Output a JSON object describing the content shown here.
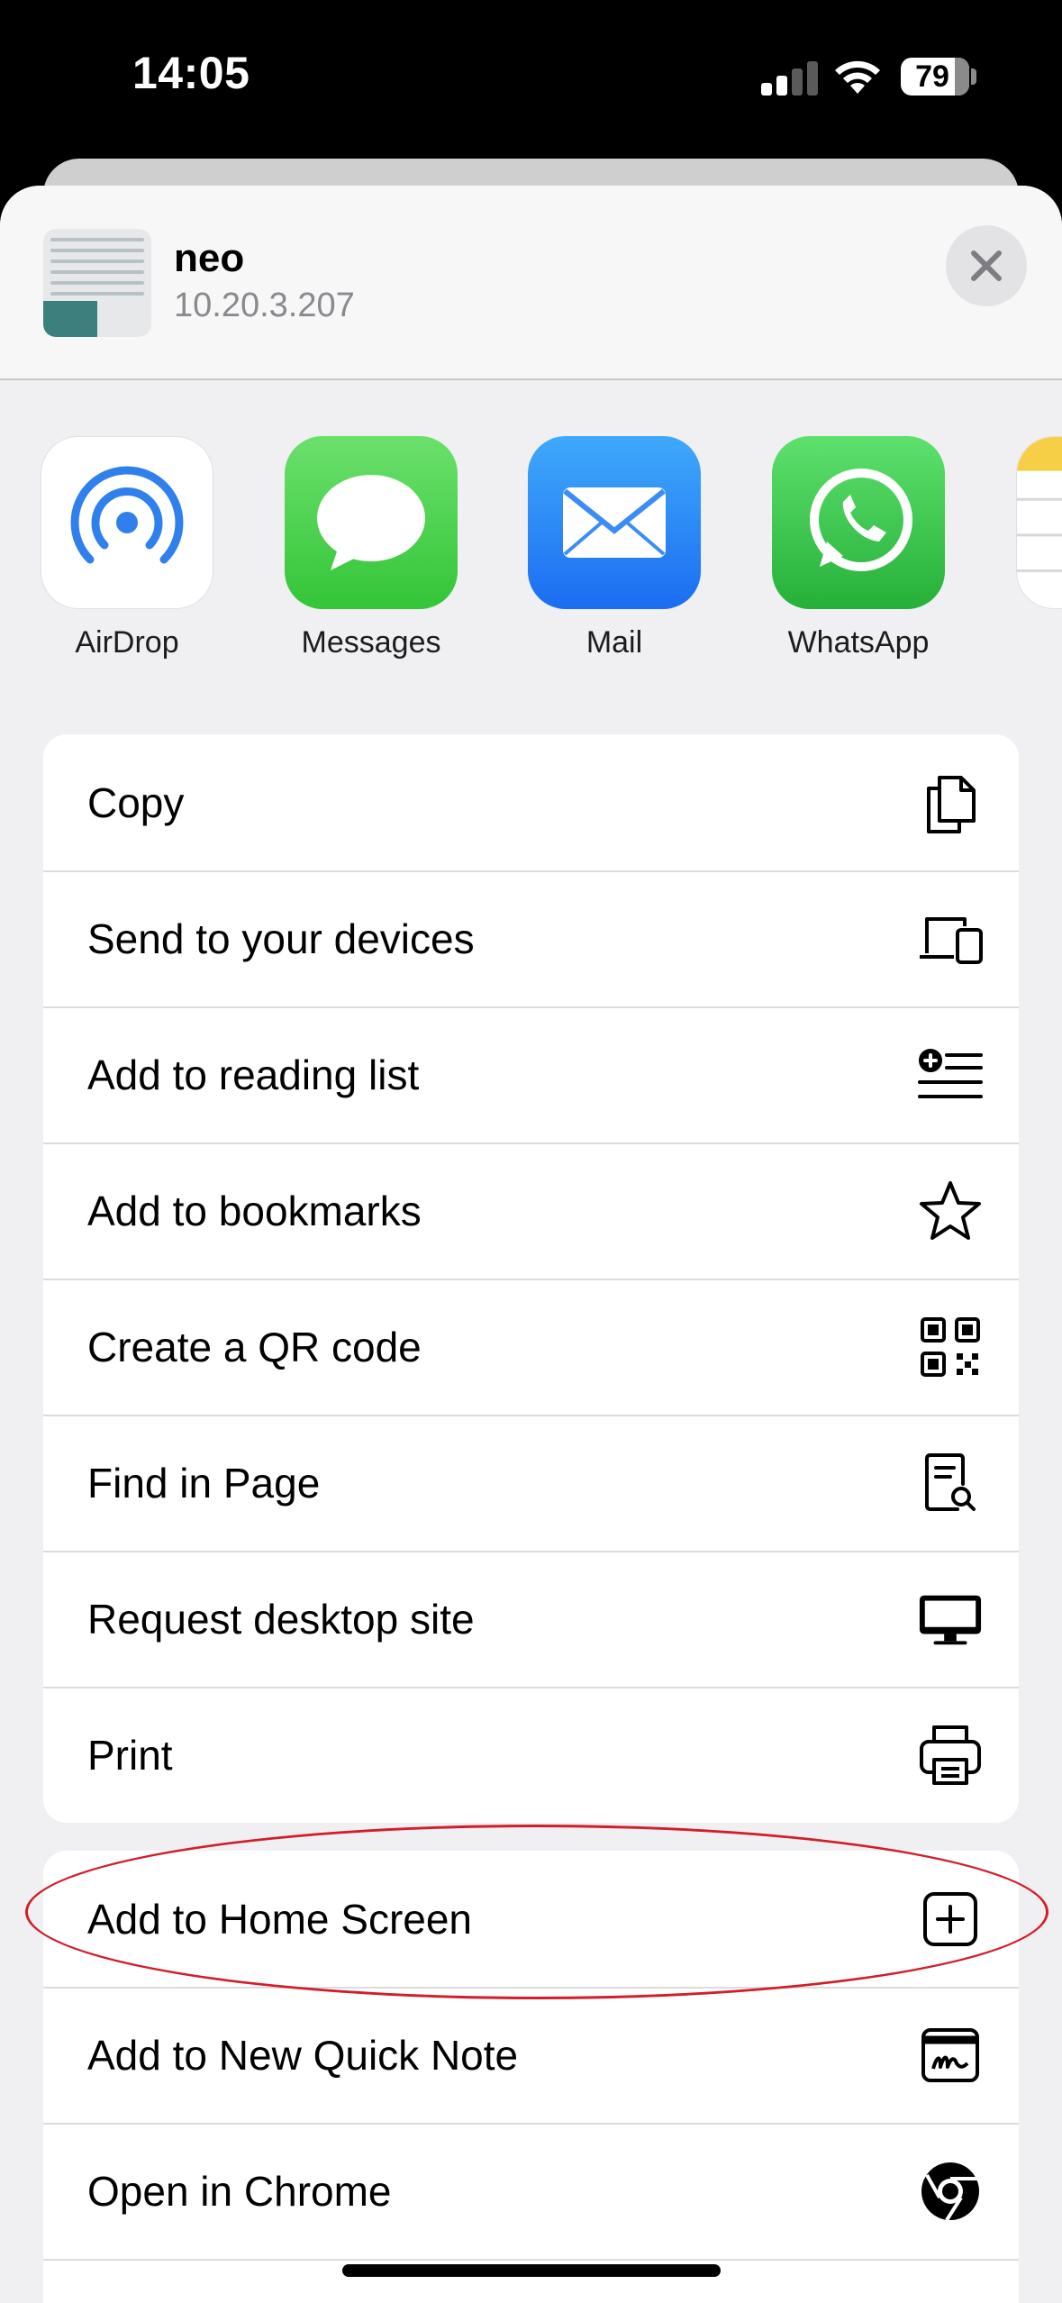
{
  "status_bar": {
    "time": "14:05",
    "battery_percent": "79",
    "battery_level": 0.79,
    "signal_bars": 2
  },
  "share_sheet": {
    "title": "neo",
    "subtitle": "10.20.3.207",
    "close_icon": "close-icon"
  },
  "apps": [
    {
      "label": "AirDrop",
      "icon": "airdrop-icon"
    },
    {
      "label": "Messages",
      "icon": "messages-icon"
    },
    {
      "label": "Mail",
      "icon": "mail-icon"
    },
    {
      "label": "WhatsApp",
      "icon": "whatsapp-icon"
    },
    {
      "label": "",
      "icon": "notes-icon"
    }
  ],
  "actions_group1": [
    {
      "label": "Copy",
      "icon": "copy-icon"
    },
    {
      "label": "Send to your devices",
      "icon": "devices-icon"
    },
    {
      "label": "Add to reading list",
      "icon": "reading-list-icon"
    },
    {
      "label": "Add to bookmarks",
      "icon": "star-icon"
    },
    {
      "label": "Create a QR code",
      "icon": "qr-code-icon"
    },
    {
      "label": "Find in Page",
      "icon": "find-in-page-icon"
    },
    {
      "label": "Request desktop site",
      "icon": "desktop-icon"
    },
    {
      "label": "Print",
      "icon": "printer-icon"
    }
  ],
  "actions_group2": [
    {
      "label": "Add to Home Screen",
      "icon": "plus-square-icon",
      "highlighted": true
    },
    {
      "label": "Add to New Quick Note",
      "icon": "quick-note-icon"
    },
    {
      "label": "Open in Chrome",
      "icon": "chrome-icon"
    }
  ],
  "colors": {
    "highlight": "#d21d2a",
    "sheet_background": "#f0f0f2",
    "row_background": "#ffffff"
  }
}
